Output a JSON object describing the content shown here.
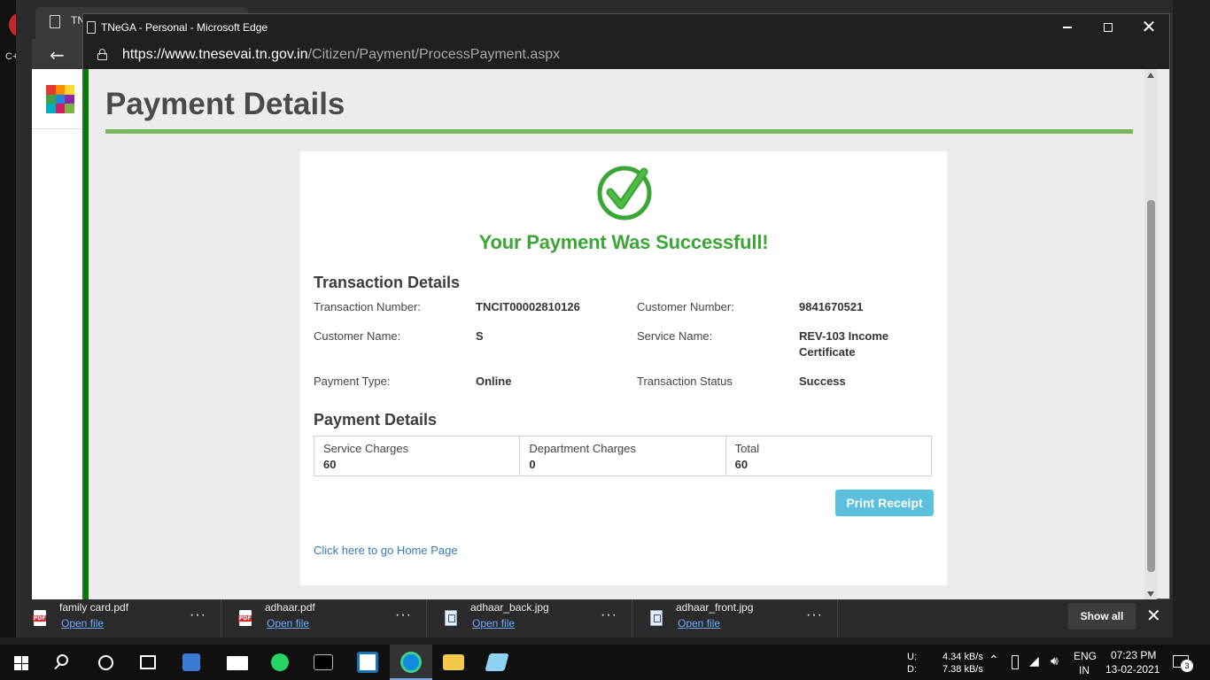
{
  "background_window": {
    "tab_title": "TNeG",
    "side_label": "PD",
    "left_fragment": "C+"
  },
  "popup": {
    "window_title": "TNeGA - Personal - Microsoft Edge",
    "url_host": "https://www.tnesevai.tn.gov.in",
    "url_path": "/Citizen/Payment/ProcessPayment.aspx"
  },
  "page": {
    "heading": "Payment Details",
    "success_message": "Your Payment Was Successfull!",
    "transaction_section_title": "Transaction Details",
    "transaction": {
      "transaction_number_label": "Transaction Number:",
      "transaction_number_value": "TNCIT00002810126",
      "customer_number_label": "Customer Number:",
      "customer_number_value": "9841670521",
      "customer_name_label": "Customer Name:",
      "customer_name_value": "S",
      "service_name_label": "Service Name:",
      "service_name_value": "REV-103 Income Certificate",
      "payment_type_label": "Payment Type:",
      "payment_type_value": "Online",
      "transaction_status_label": "Transaction Status",
      "transaction_status_value": "Success"
    },
    "payment_section_title": "Payment Details",
    "charges": [
      {
        "label": "Service Charges",
        "value": "60"
      },
      {
        "label": "Department Charges",
        "value": "0"
      },
      {
        "label": "Total",
        "value": "60"
      }
    ],
    "print_button": "Print Receipt",
    "home_link": "Click here to go Home Page"
  },
  "downloads": {
    "items": [
      {
        "name": "family card.pdf",
        "action": "Open file",
        "type": "pdf"
      },
      {
        "name": "adhaar.pdf",
        "action": "Open file",
        "type": "pdf"
      },
      {
        "name": "adhaar_back.jpg",
        "action": "Open file",
        "type": "image"
      },
      {
        "name": "adhaar_front.jpg",
        "action": "Open file",
        "type": "image"
      }
    ],
    "more_label": "···",
    "show_all": "Show all",
    "close_glyph": "✕"
  },
  "taskbar": {
    "net_upload_label": "U:",
    "net_download_label": "D:",
    "net_upload": "4.34 kB/s",
    "net_download": "7.38 kB/s",
    "language": "ENG",
    "region": "IN",
    "time": "07:23 PM",
    "date": "13-02-2021",
    "notifications": "3"
  },
  "colors": {
    "success_green": "#3aa635",
    "frame_green": "#0b7a0b",
    "print_button": "#5bc0de",
    "link_blue": "#337ab7"
  }
}
